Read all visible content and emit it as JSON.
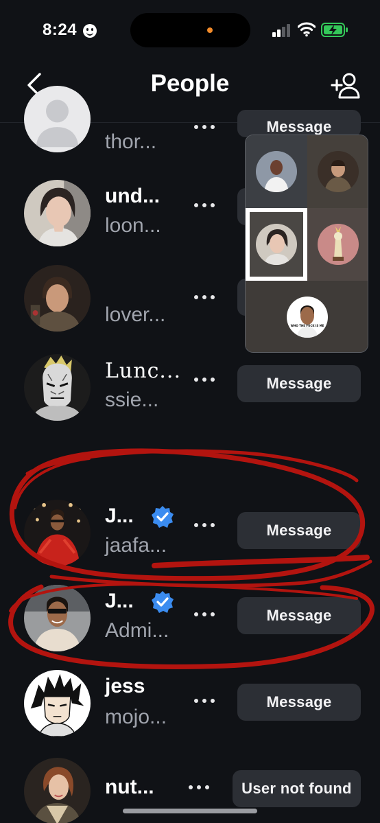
{
  "status_bar": {
    "time": "8:24"
  },
  "header": {
    "title": "People"
  },
  "rows": [
    {
      "name": "",
      "subtitle": "thor...",
      "button": "Message"
    },
    {
      "name": "und...",
      "subtitle": "loon...",
      "button": ""
    },
    {
      "name": "",
      "subtitle": "lover...",
      "button": ""
    },
    {
      "name": "Lunc...",
      "subtitle": "ssie...",
      "button": "Message"
    },
    {
      "name": "J...",
      "subtitle": "jaafa...",
      "button": "Message",
      "verified": true
    },
    {
      "name": "J...",
      "subtitle": "Admi...",
      "button": "Message",
      "verified": true
    },
    {
      "name": "jess",
      "subtitle": "mojo...",
      "button": "Message"
    },
    {
      "name": "nut...",
      "subtitle": "",
      "button": "User not found"
    }
  ],
  "video_grid": {
    "tile_caption": "WHO THE FUCK IS ME"
  },
  "colors": {
    "background": "#101216",
    "button": "#2c2f35",
    "verified": "#3b8cf0",
    "annotation": "#b3140f",
    "battery": "#34c759"
  },
  "icons": [
    "back-chevron-icon",
    "add-person-icon",
    "more-icon",
    "verified-icon",
    "signal-icon",
    "wifi-icon",
    "battery-charging-icon"
  ]
}
